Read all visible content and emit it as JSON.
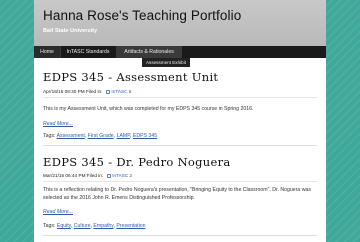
{
  "site": {
    "title": "Hanna Rose's Teaching Portfolio",
    "description": "Ball State University"
  },
  "nav": {
    "items": [
      "Home",
      "InTASC Standards",
      "Artifacts & Rationales"
    ],
    "submenu_item": "Assessment Exhibit"
  },
  "posts": [
    {
      "title": "EDPS 345 - Assessment Unit",
      "date": "Apr/18/16 08:30 PM Filed in:",
      "category": "InTASC 6",
      "excerpt": "This is my Assessment Unit, which was completed for my EDPS 345 course in Spring 2016.",
      "read_more": "Read More...",
      "tags_label": "Tags:",
      "tags": [
        "Assessment",
        "First Grade",
        "LAMP",
        "EDPS 345"
      ]
    },
    {
      "title": "EDPS 345 - Dr. Pedro Noguera",
      "date": "Mar/21/16 06:44 PM Filed in:",
      "category": "InTASC 2",
      "excerpt": "This is a reflection relating to Dr. Pedro Noguera's presentation, \"Bringing Equity to the Classroom\". Dr. Noguera was selected as the 2016 John R. Emens Distinguished Professorship.",
      "read_more": "Read More...",
      "tags_label": "Tags:",
      "tags": [
        "Equity",
        "Culture",
        "Empathy",
        "Presentation"
      ]
    }
  ],
  "colors": {
    "background": "#3fa89a",
    "header": "#c0c0c0",
    "nav": "#1a1a1a",
    "link": "#3359a8"
  }
}
